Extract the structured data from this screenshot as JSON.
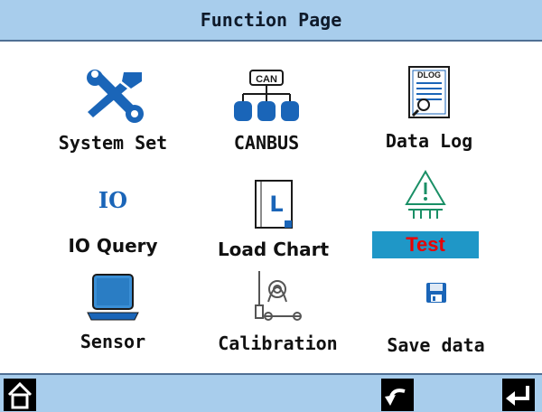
{
  "header": {
    "title": "Function Page"
  },
  "functions": [
    {
      "label": "System Set",
      "icon": "wrench-screwdriver-icon"
    },
    {
      "label": "CANBUS",
      "icon": "can-network-icon",
      "icon_text": "CAN"
    },
    {
      "label": "Data Log",
      "icon": "data-log-document-icon",
      "icon_text": "DLOG"
    },
    {
      "label": "IO Query",
      "icon": "io-icon",
      "icon_text": "IO"
    },
    {
      "label": "Load Chart",
      "icon": "load-chart-book-icon",
      "icon_text": "L"
    },
    {
      "label": "Test",
      "icon": "warning-triangle-icon",
      "selected": true
    },
    {
      "label": "Sensor",
      "icon": "monitor-sensor-icon"
    },
    {
      "label": "Calibration",
      "icon": "calibration-tools-icon"
    },
    {
      "label": "Save data",
      "icon": "floppy-disk-icon"
    }
  ],
  "bottom_bar": {
    "buttons": [
      {
        "name": "home",
        "icon": "home-icon"
      },
      {
        "name": "back",
        "icon": "undo-arrow-icon"
      },
      {
        "name": "enter",
        "icon": "enter-return-icon"
      }
    ]
  },
  "colors": {
    "bar_background": "#a8cdec",
    "selected_background": "#1f97c7",
    "selected_text": "#e80000",
    "icon_blue": "#1a65b8"
  }
}
